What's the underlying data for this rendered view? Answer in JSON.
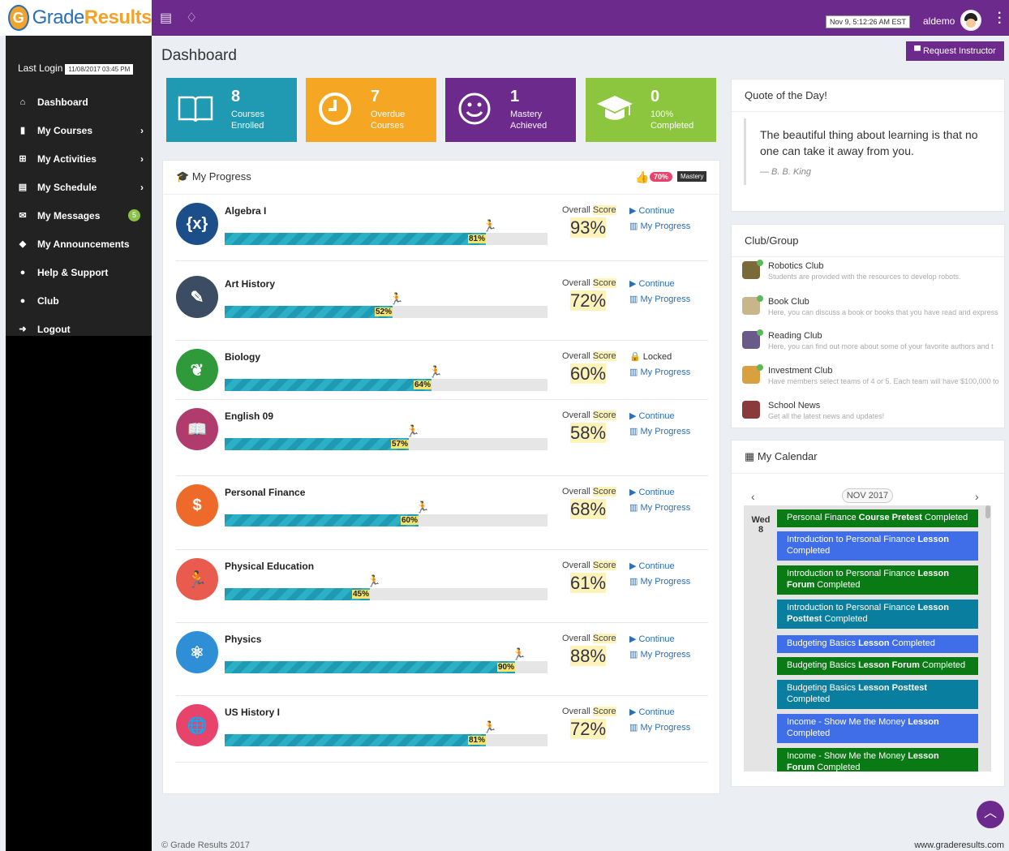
{
  "header": {
    "logo_mark": "G",
    "logo_part1": "Grade",
    "logo_part2": "Results",
    "clock": "Nov 9, 5:12:26 AM EST",
    "username": "aldemo"
  },
  "sidebar": {
    "last_login_label": "Last Login",
    "last_login_date": "11/08/2017 03:45 PM",
    "items": [
      {
        "label": "Dashboard",
        "icon": "home-icon",
        "glyph": "⌂",
        "chevron": ""
      },
      {
        "label": "My Courses",
        "icon": "book-icon",
        "glyph": "▮",
        "chevron": "›"
      },
      {
        "label": "My Activities",
        "icon": "institution-icon",
        "glyph": "⊞",
        "chevron": "›"
      },
      {
        "label": "My Schedule",
        "icon": "keyboard-icon",
        "glyph": "▤",
        "chevron": "›"
      },
      {
        "label": "My Messages",
        "icon": "envelope-icon",
        "glyph": "✉",
        "chevron": "",
        "badge": "5"
      },
      {
        "label": "My Announcements",
        "icon": "bell-icon",
        "glyph": "◆",
        "chevron": ""
      },
      {
        "label": "Help & Support",
        "icon": "help-icon",
        "glyph": "●",
        "chevron": ""
      },
      {
        "label": "Club",
        "icon": "club-icon",
        "glyph": "●",
        "chevron": ""
      },
      {
        "label": "Logout",
        "icon": "logout-icon",
        "glyph": "➜",
        "chevron": ""
      }
    ]
  },
  "page": {
    "title": "Dashboard",
    "request_button": "Request Instructor"
  },
  "stats": [
    {
      "num": "8",
      "line1": "Courses",
      "line2": "Enrolled",
      "color": "#1f9ab2",
      "icon": "book-open-icon"
    },
    {
      "num": "7",
      "line1": "Overdue",
      "line2": "Courses",
      "color": "#f5a623",
      "icon": "clock-icon"
    },
    {
      "num": "1",
      "line1": "Mastery",
      "line2": "Achieved",
      "color": "#6c2a8c",
      "icon": "smile-icon"
    },
    {
      "num": "0",
      "line1": "100%",
      "line2": "Completed",
      "color": "#8cc63f",
      "icon": "graduation-cap-icon"
    }
  ],
  "progress": {
    "title": "My Progress",
    "mastery_pct": "70%",
    "mastery_label": "Mastery",
    "score_label_a": "Overall ",
    "score_label_b": "Score",
    "courses": [
      {
        "name": "Algebra I",
        "pct": 81,
        "pct_label": "81%",
        "score": "93%",
        "action": "Continue",
        "progress_link": "My Progress",
        "color": "#1c4f8a",
        "glyph": "{x}",
        "icon": "algebra-icon"
      },
      {
        "name": "Art History",
        "pct": 52,
        "pct_label": "52%",
        "score": "72%",
        "action": "Continue",
        "progress_link": "My Progress",
        "color": "#3c4d63",
        "glyph": "✎",
        "icon": "art-easel-icon"
      },
      {
        "name": "Biology",
        "pct": 64,
        "pct_label": "64%",
        "score": "60%",
        "action": "Locked",
        "progress_link": "My Progress",
        "color": "#2e9a3a",
        "glyph": "❦",
        "icon": "biology-icon"
      },
      {
        "name": "English 09",
        "pct": 57,
        "pct_label": "57%",
        "score": "58%",
        "action": "Continue",
        "progress_link": "My Progress",
        "color": "#b03c6d",
        "glyph": "📖",
        "icon": "open-book-icon"
      },
      {
        "name": "Personal Finance",
        "pct": 60,
        "pct_label": "60%",
        "score": "68%",
        "action": "Continue",
        "progress_link": "My Progress",
        "color": "#ee6a2b",
        "glyph": "$",
        "icon": "piggy-bank-icon"
      },
      {
        "name": "Physical Education",
        "pct": 45,
        "pct_label": "45%",
        "score": "61%",
        "action": "Continue",
        "progress_link": "My Progress",
        "color": "#e85b4e",
        "glyph": "🏃",
        "icon": "runner-icon"
      },
      {
        "name": "Physics",
        "pct": 90,
        "pct_label": "90%",
        "score": "88%",
        "action": "Continue",
        "progress_link": "My Progress",
        "color": "#2f8fd6",
        "glyph": "⚛",
        "icon": "atom-icon"
      },
      {
        "name": "US History I",
        "pct": 81,
        "pct_label": "81%",
        "score": "72%",
        "action": "Continue",
        "progress_link": "My Progress",
        "color": "#e8436a",
        "glyph": "🌐",
        "icon": "globe-icon"
      }
    ]
  },
  "quote": {
    "title": "Quote of the Day!",
    "text": "The beautiful thing about learning is that no one can take it away from you.",
    "author": "— B. B. King"
  },
  "clubs": {
    "title": "Club/Group",
    "items": [
      {
        "name": "Robotics Club",
        "desc": "Students are provided with the resources to develop robots.",
        "color": "#7a6a3a"
      },
      {
        "name": "Book Club",
        "desc": "Here, you can discuss a book or books that you have read and express",
        "color": "#c9b58a"
      },
      {
        "name": "Reading Club",
        "desc": "Here, you can find out more about some of your favorite authors and t",
        "color": "#6a5a8a"
      },
      {
        "name": "Investment Club",
        "desc": "Have members select teams of 4 or 5. Each team will have $100,000 to",
        "color": "#d9a040"
      },
      {
        "name": "School News",
        "desc": "Get all the latest news and updates!",
        "color": "#8a3a3a"
      }
    ]
  },
  "calendar": {
    "title": "My Calendar",
    "month": "NOV 2017",
    "day_name": "Wed",
    "day_num": "8",
    "events": [
      {
        "a": "Personal Finance ",
        "b": "Course Pretest",
        "c": " Completed",
        "color": "#0a7a14"
      },
      {
        "a": "Introduction to Personal Finance ",
        "b": "Lesson",
        "c": " Completed",
        "color": "#3f6ee8"
      },
      {
        "a": "Introduction to Personal Finance ",
        "b": "Lesson Forum",
        "c": " Completed",
        "color": "#0a7a14"
      },
      {
        "a": "Introduction to Personal Finance ",
        "b": "Lesson Posttest",
        "c": " Completed",
        "color": "#0a7e9e"
      },
      {
        "a": "Budgeting Basics ",
        "b": "Lesson",
        "c": " Completed",
        "color": "#3f6ee8"
      },
      {
        "a": "Budgeting Basics ",
        "b": "Lesson Forum",
        "c": " Completed",
        "color": "#0a7a14"
      },
      {
        "a": "Budgeting Basics ",
        "b": "Lesson Posttest",
        "c": " Completed",
        "color": "#0a7e9e"
      },
      {
        "a": "Income - Show Me the Money ",
        "b": "Lesson",
        "c": " Completed",
        "color": "#3f6ee8"
      },
      {
        "a": "Income - Show Me the Money ",
        "b": "Lesson Forum",
        "c": " Completed",
        "color": "#0a7a14"
      }
    ]
  },
  "footer": {
    "copyright": "© Grade Results 2017",
    "website": "www.graderesults.com"
  }
}
